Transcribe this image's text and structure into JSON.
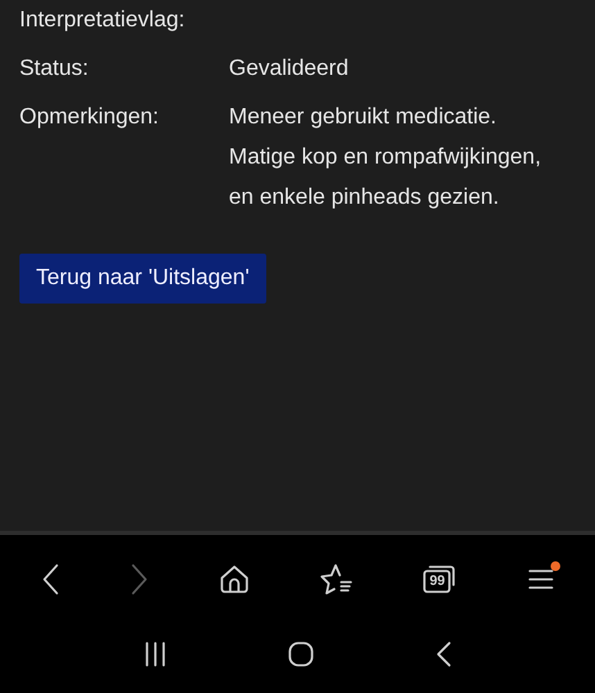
{
  "details": {
    "rows": [
      {
        "label": "Interpretatievlag:",
        "values": []
      },
      {
        "label": "Status:",
        "values": [
          "Gevalideerd"
        ]
      },
      {
        "label": "Opmerkingen:",
        "values": [
          "Meneer gebruikt medicatie.",
          "Matige kop en rompafwijkingen,",
          "en enkele pinheads gezien."
        ]
      }
    ]
  },
  "back_button": {
    "label": "Terug naar 'Uitslagen'"
  },
  "browser_toolbar": {
    "items": [
      {
        "kind": "back",
        "disabled": false
      },
      {
        "kind": "forward",
        "disabled": true
      },
      {
        "kind": "home",
        "disabled": false
      },
      {
        "kind": "bookmarks",
        "disabled": false
      },
      {
        "kind": "tabs",
        "count": "99",
        "disabled": false
      },
      {
        "kind": "menu",
        "notification": true,
        "disabled": false
      }
    ]
  },
  "system_nav": {
    "items": [
      {
        "kind": "recents"
      },
      {
        "kind": "home"
      },
      {
        "kind": "back"
      }
    ]
  }
}
